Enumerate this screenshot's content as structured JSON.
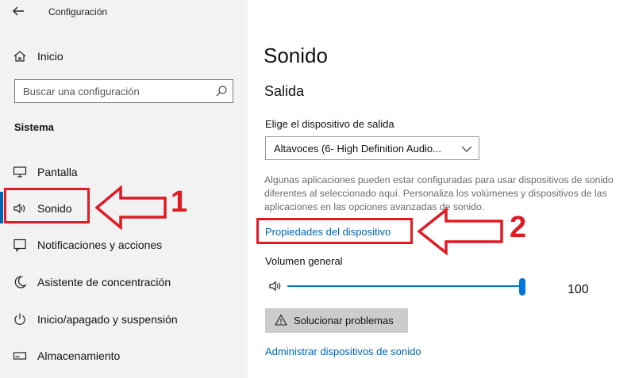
{
  "window": {
    "title": "Configuración",
    "back_icon": "back-arrow-icon"
  },
  "sidebar": {
    "home": {
      "label": "Inicio",
      "icon": "home-icon"
    },
    "search": {
      "placeholder": "Buscar una configuración",
      "icon": "search-icon"
    },
    "section": "Sistema",
    "items": [
      {
        "label": "Pantalla",
        "icon": "monitor-icon"
      },
      {
        "label": "Sonido",
        "icon": "speaker-icon",
        "selected": true
      },
      {
        "label": "Notificaciones y acciones",
        "icon": "notification-icon"
      },
      {
        "label": "Asistente de concentración",
        "icon": "moon-icon"
      },
      {
        "label": "Inicio/apagado y suspensión",
        "icon": "power-icon"
      },
      {
        "label": "Almacenamiento",
        "icon": "storage-icon"
      }
    ]
  },
  "main": {
    "title": "Sonido",
    "output": {
      "heading": "Salida",
      "device_label": "Elige el dispositivo de salida",
      "device_value": "Altavoces (6- High Definition Audio...",
      "info": "Algunas aplicaciones pueden estar configuradas para usar dispositivos de sonido diferentes al seleccionado aquí. Personaliza los volúmenes y dispositivos de las aplicaciones en las opciones avanzadas de sonido.",
      "properties_link": "Propiedades del dispositivo",
      "volume_label": "Volumen general",
      "volume_value": "100",
      "volume_level": 100,
      "troubleshoot_label": "Solucionar problemas",
      "manage_link": "Administrar dispositivos de sonido"
    }
  },
  "annotations": {
    "label_1": "1",
    "label_2": "2",
    "color": "#e01b24"
  },
  "colors": {
    "accent": "#0078d7",
    "link": "#0063b1",
    "sidebar_bg": "#f2f2f2"
  }
}
